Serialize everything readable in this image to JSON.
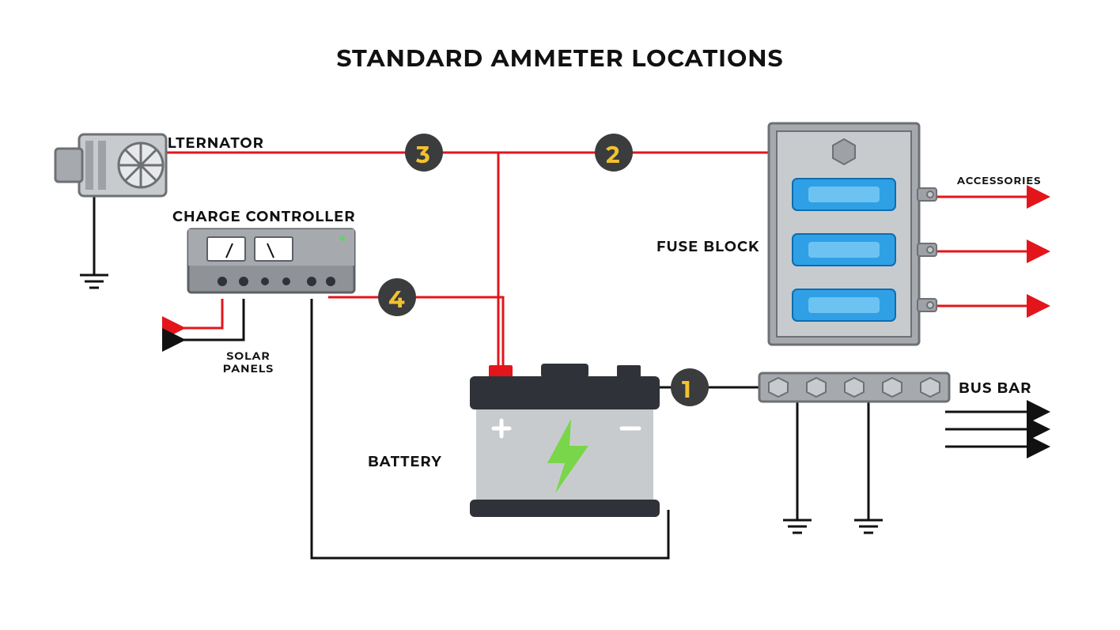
{
  "title": "STANDARD AMMETER LOCATIONS",
  "labels": {
    "alternator": "ALTERNATOR",
    "charge_controller": "CHARGE CONTROLLER",
    "solar_panels_line1": "SOLAR",
    "solar_panels_line2": "PANELS",
    "battery": "BATTERY",
    "fuse_block": "FUSE BLOCK",
    "bus_bar": "BUS BAR",
    "accessories": "ACCESSORIES"
  },
  "markers": {
    "m1": "1",
    "m2": "2",
    "m3": "3",
    "m4": "4"
  },
  "colors": {
    "red": "#E3151B",
    "black": "#111111",
    "dark": "#2F3339",
    "mid_gray": "#A6AAAE",
    "light_gray": "#C8CBCE",
    "blue": "#2FA0E5",
    "green": "#79D64A",
    "yellow": "#F2C22E"
  },
  "diagram_description": "Electrical wiring diagram showing four numbered ammeter measurement locations: (1) between battery negative and bus bar, (2) between battery positive and fuse block, (3) between alternator output and battery positive, (4) between charge controller output and battery positive. The alternator case is grounded. The charge controller connects to solar panels. The fuse block feeds accessories (positive). The bus bar provides ground distribution.",
  "components": [
    "alternator",
    "charge_controller",
    "battery",
    "fuse_block",
    "bus_bar"
  ]
}
